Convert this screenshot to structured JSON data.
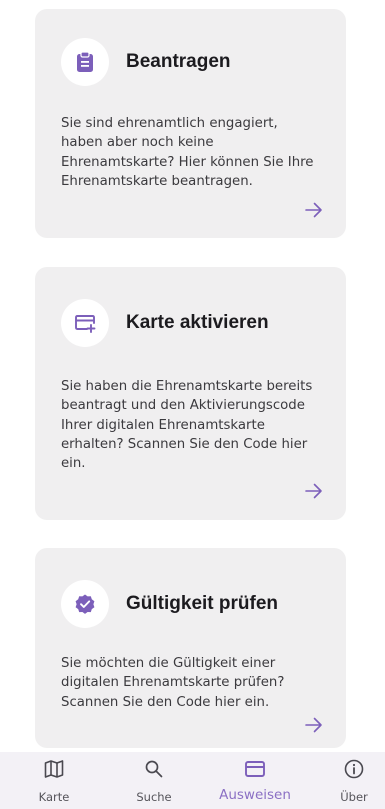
{
  "colors": {
    "accent": "#7c5fba",
    "card_background": "#f0eff0",
    "nav_background": "#f3f1f6"
  },
  "cards": [
    {
      "icon": "clipboard-icon",
      "title": "Beantragen",
      "text": "Sie sind ehrenamtlich engagiert, haben aber noch keine Ehrenamtskarte? Hier können Sie Ihre Ehrenamtskarte beantragen.",
      "action_icon": "arrow-right-icon"
    },
    {
      "icon": "card-add-icon",
      "title": "Karte aktivieren",
      "text": "Sie haben die Ehrenamtskarte bereits beantragt und den Aktivierungscode Ihrer digitalen Ehrenamtskarte erhalten? Scannen Sie den Code hier ein.",
      "action_icon": "arrow-right-icon"
    },
    {
      "icon": "verified-icon",
      "title": "Gültigkeit prüfen",
      "text": "Sie möchten die Gültigkeit einer digitalen Ehrenamtskarte prüfen? Scannen Sie den Code hier ein.",
      "action_icon": "arrow-right-icon"
    }
  ],
  "nav": {
    "items": [
      {
        "label": "Karte",
        "icon": "map-icon",
        "active": false
      },
      {
        "label": "Suche",
        "icon": "search-icon",
        "active": false
      },
      {
        "label": "Ausweisen",
        "icon": "card-icon",
        "active": true
      },
      {
        "label": "Über",
        "icon": "info-icon",
        "active": false
      }
    ]
  }
}
